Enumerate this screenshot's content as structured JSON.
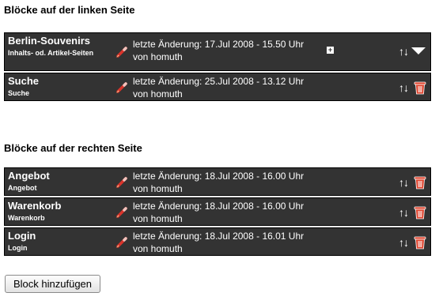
{
  "left_section": {
    "title": "Blöcke auf der linken Seite",
    "blocks": [
      {
        "name": "Berlin-Souvenirs",
        "type": "Inhalts- od. Artikel-Seiten",
        "changed": "letzte Änderung: 17.Jul 2008 - 15.50 Uhr",
        "author": "von homuth"
      },
      {
        "name": "Suche",
        "type": "Suche",
        "changed": "letzte Änderung: 25.Jul 2008 - 13.12 Uhr",
        "author": "von homuth"
      }
    ]
  },
  "right_section": {
    "title": "Blöcke auf der rechten Seite",
    "blocks": [
      {
        "name": "Angebot",
        "type": "Angebot",
        "changed": "letzte Änderung: 18.Jul 2008 - 16.00 Uhr",
        "author": "von homuth"
      },
      {
        "name": "Warenkorb",
        "type": "Warenkorb",
        "changed": "letzte Änderung: 18.Jul 2008 - 16.00 Uhr",
        "author": "von homuth"
      },
      {
        "name": "Login",
        "type": "Login",
        "changed": "letzte Änderung: 18.Jul 2008 - 16.01 Uhr",
        "author": "von homuth"
      }
    ]
  },
  "icons": {
    "move": "↑↓",
    "expand": "+"
  },
  "add_button_label": "Block hinzufügen",
  "colors": {
    "row_background": "#333333",
    "pencil": "#d9342b",
    "trash": "#e0452f"
  }
}
